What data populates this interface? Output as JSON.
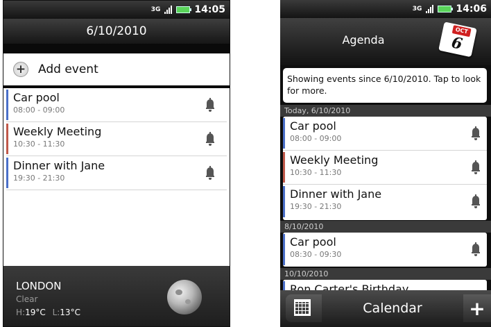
{
  "status_bar": {
    "network": "3G",
    "time": "14:05"
  },
  "status_bar_2": {
    "network": "3G",
    "time": "14:06"
  },
  "day_view": {
    "title": "6/10/2010",
    "add_event_label": "Add event",
    "events": [
      {
        "title": "Car pool",
        "time": "08:00 - 09:00",
        "color": "#4a6fc8"
      },
      {
        "title": "Weekly Meeting",
        "time": "10:30 - 11:30",
        "color": "#c0584a"
      },
      {
        "title": "Dinner with Jane",
        "time": "19:30 - 21:30",
        "color": "#4a6fc8"
      }
    ],
    "weather": {
      "city": "LONDON",
      "condition": "Clear",
      "high_label": "H:",
      "high": "19°C",
      "low_label": "L:",
      "low": "13°C",
      "icon": "moon-icon"
    }
  },
  "agenda_view": {
    "title": "Agenda",
    "calendar_icon": {
      "month": "OCT",
      "day": "6"
    },
    "banner": "Showing events since 6/10/2010. Tap to look for more.",
    "groups": [
      {
        "date": "Today, 6/10/2010",
        "events": [
          {
            "title": "Car pool",
            "time": "08:00 - 09:00",
            "color": "#4a6fc8"
          },
          {
            "title": "Weekly Meeting",
            "time": "10:30 - 11:30",
            "color": "#c0584a"
          },
          {
            "title": "Dinner with Jane",
            "time": "19:30 - 21:30",
            "color": "#4a6fc8"
          }
        ]
      },
      {
        "date": "8/10/2010",
        "events": [
          {
            "title": "Car pool",
            "time": "08:30 - 09:30",
            "color": "#4a6fc8"
          }
        ]
      },
      {
        "date": "10/10/2010",
        "events": [
          {
            "title": "Ron Carter's Birthday",
            "time": "",
            "color": "#4a6fc8"
          }
        ]
      }
    ],
    "bottom_bar": {
      "label": "Calendar",
      "plus": "+"
    }
  }
}
